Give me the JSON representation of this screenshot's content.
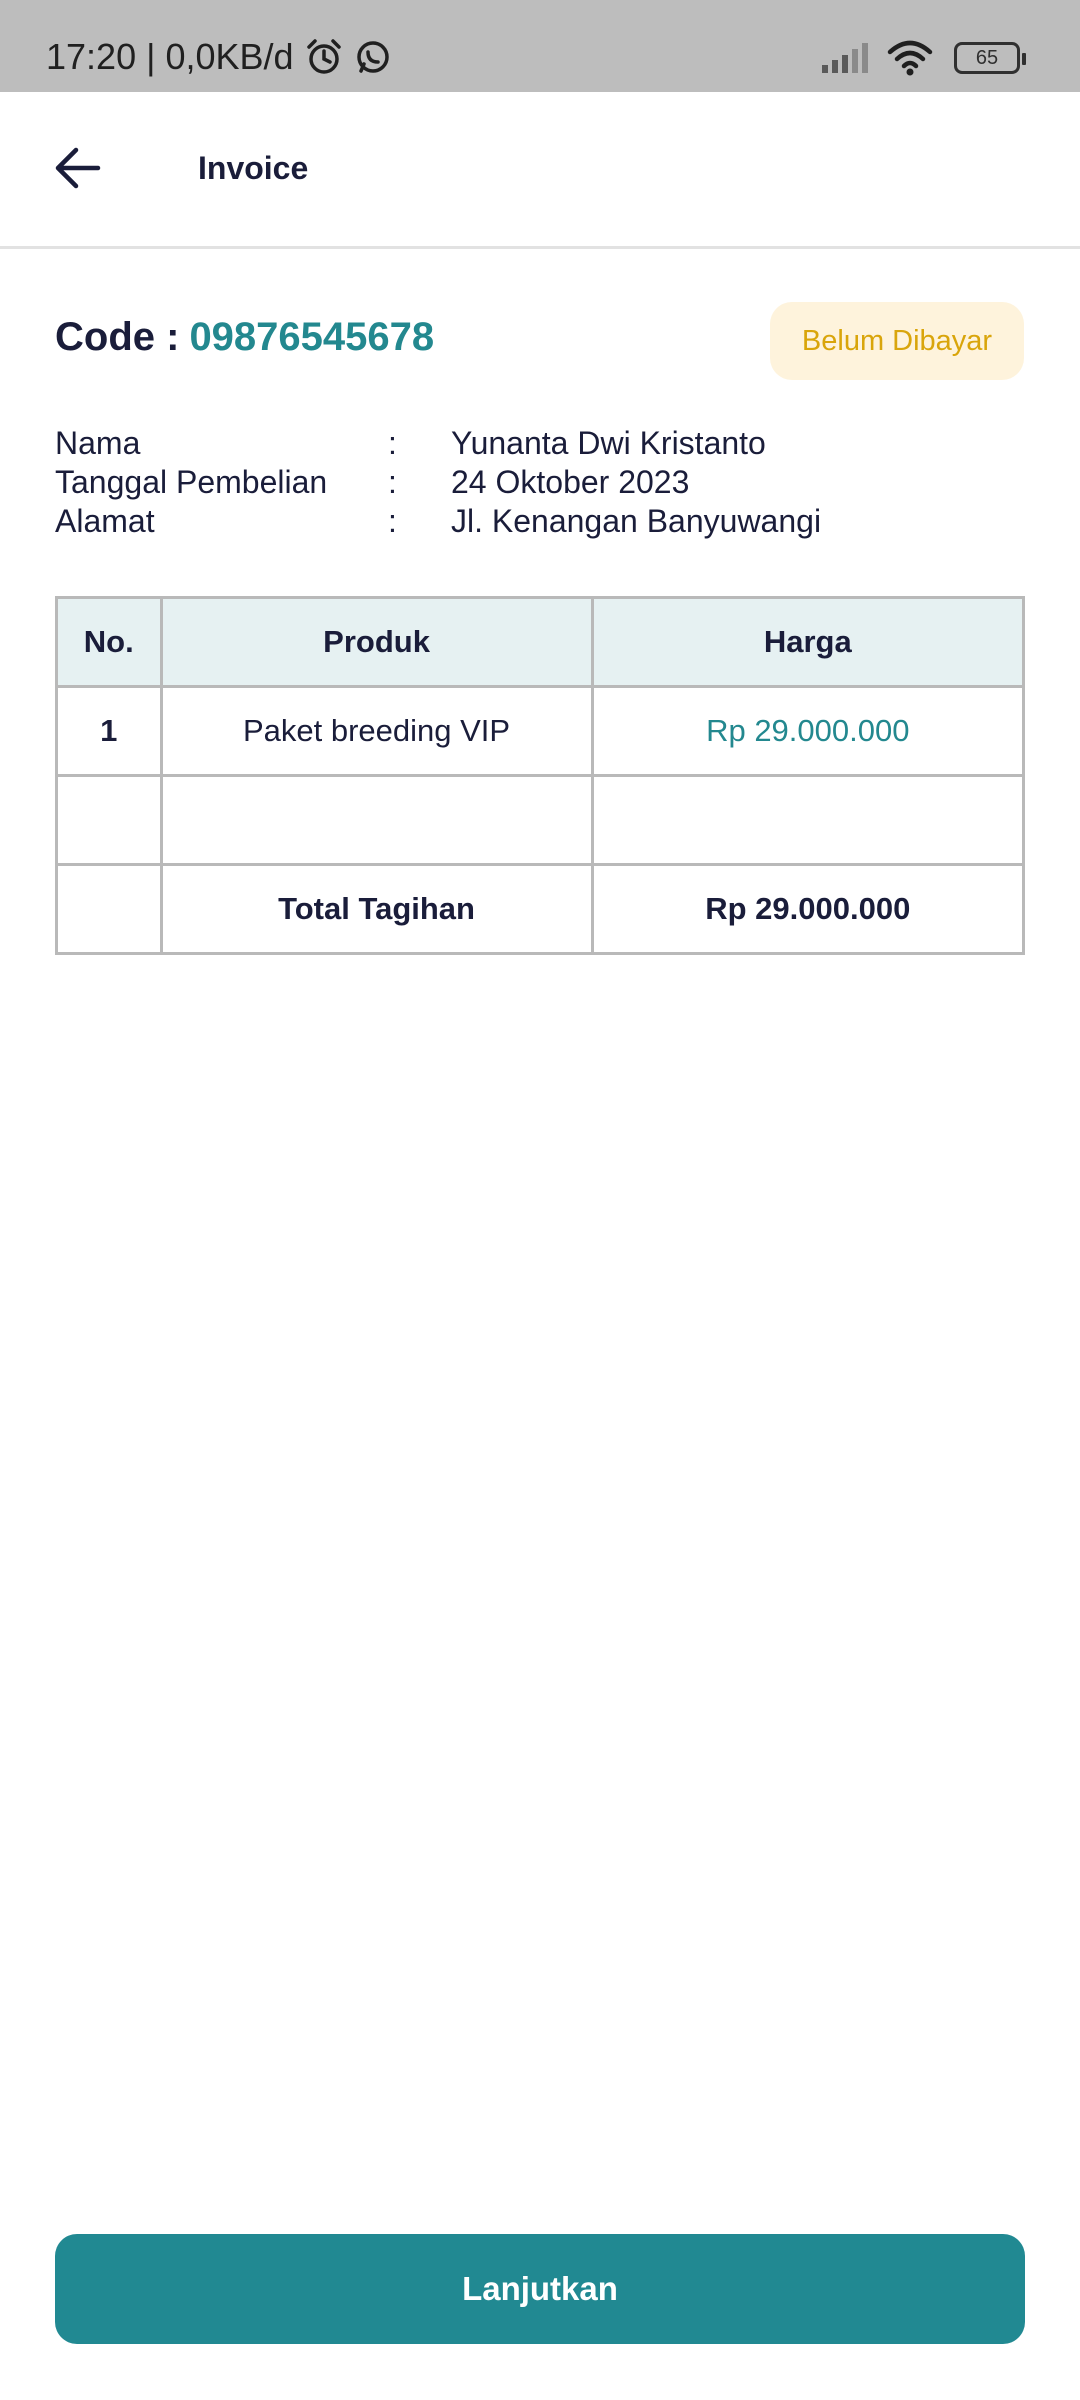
{
  "status_bar": {
    "time": "17:20",
    "separator": "|",
    "data_rate": "0,0KB/d",
    "battery_level": "65"
  },
  "header": {
    "title": "Invoice",
    "back_icon": "arrow-left-icon"
  },
  "invoice": {
    "code_label": "Code :",
    "code_value": "09876545678",
    "status_badge": "Belum Dibayar",
    "details": [
      {
        "label": "Nama",
        "colon": ":",
        "value": "Yunanta Dwi Kristanto"
      },
      {
        "label": "Tanggal Pembelian",
        "colon": ":",
        "value": "24 Oktober 2023"
      },
      {
        "label": "Alamat",
        "colon": ":",
        "value": "Jl. Kenangan Banyuwangi"
      }
    ]
  },
  "table": {
    "headers": [
      "No.",
      "Produk",
      "Harga"
    ],
    "rows": [
      {
        "no": "1",
        "product": "Paket breeding VIP",
        "price": "Rp 29.000.000"
      }
    ],
    "total_label": "Total Tagihan",
    "total_value": "Rp 29.000.000"
  },
  "actions": {
    "continue_label": "Lanjutkan"
  },
  "colors": {
    "accent": "#23888f",
    "button": "#218992",
    "badge_bg": "#fef3dc",
    "badge_text": "#d9a50b",
    "table_header_bg": "#e6f1f2"
  }
}
